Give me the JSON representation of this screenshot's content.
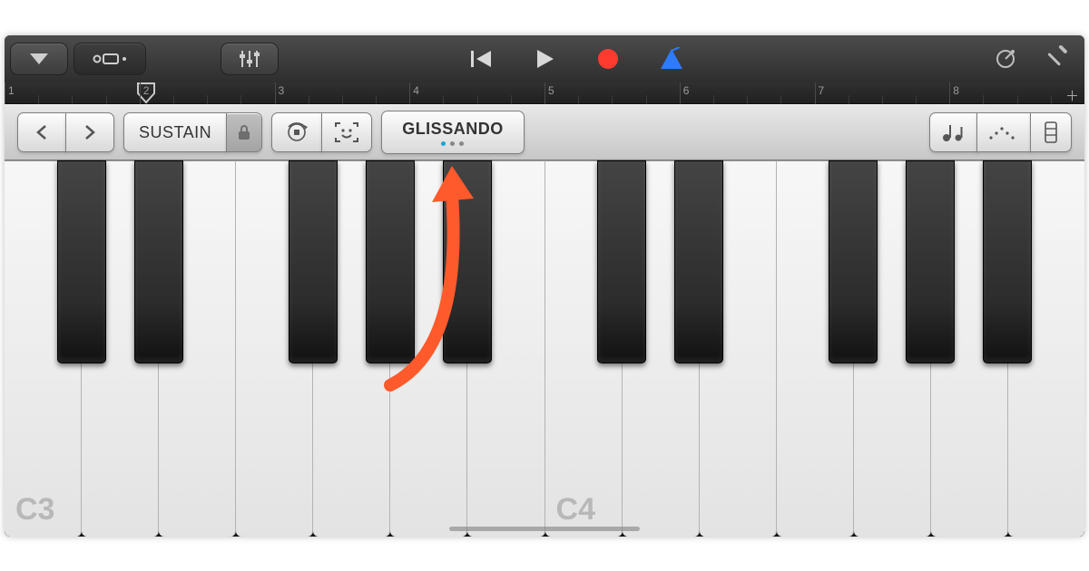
{
  "ruler": {
    "bars": [
      "1",
      "2",
      "3",
      "4",
      "5",
      "6",
      "7",
      "8"
    ],
    "playhead_bar": 2
  },
  "controls": {
    "sustain": "SUSTAIN",
    "glissando": "GLISSANDO",
    "glissando_page_count": 3,
    "glissando_page_active": 0
  },
  "keyboard": {
    "left_label": "C3",
    "center_label": "C4"
  },
  "colors": {
    "record": "#ff3b30",
    "metronome": "#2e7bff",
    "arrow": "#ff5a2b"
  }
}
